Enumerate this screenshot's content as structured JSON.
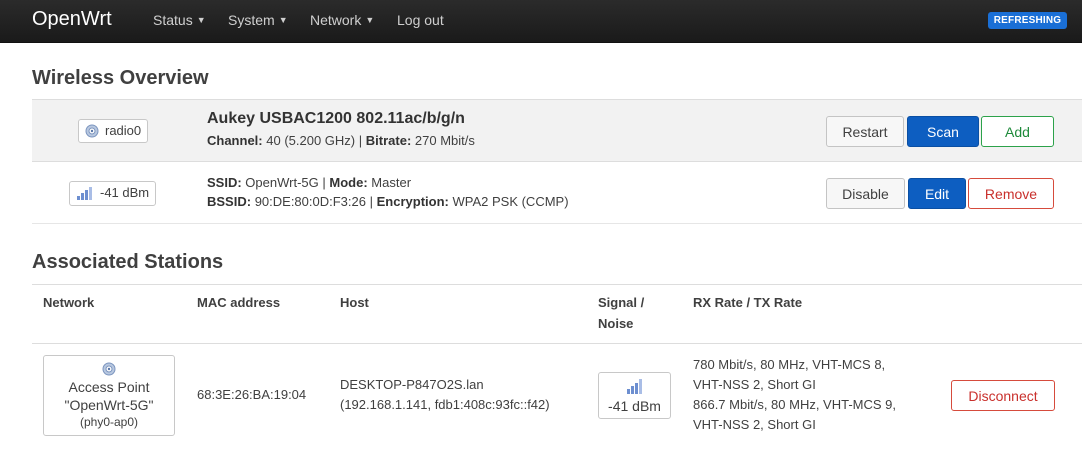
{
  "nav": {
    "brand": "OpenWrt",
    "items": [
      {
        "label": "Status",
        "dropdown": true
      },
      {
        "label": "System",
        "dropdown": true
      },
      {
        "label": "Network",
        "dropdown": true
      },
      {
        "label": "Log out",
        "dropdown": false
      }
    ],
    "status_badge": "REFRESHING"
  },
  "wireless": {
    "title": "Wireless Overview",
    "radio": {
      "badge": "radio0",
      "name": "Aukey USBAC1200 802.11ac/b/g/n",
      "channel_label": "Channel:",
      "channel_value": "40 (5.200 GHz)",
      "separator": "|",
      "bitrate_label": "Bitrate:",
      "bitrate_value": "270 Mbit/s",
      "buttons": {
        "restart": "Restart",
        "scan": "Scan",
        "add": "Add"
      }
    },
    "network": {
      "signal": "-41 dBm",
      "ssid_label": "SSID:",
      "ssid_value": "OpenWrt-5G",
      "mode_label": "Mode:",
      "mode_value": "Master",
      "bssid_label": "BSSID:",
      "bssid_value": "90:DE:80:0D:F3:26",
      "encryption_label": "Encryption:",
      "encryption_value": "WPA2 PSK (CCMP)",
      "buttons": {
        "disable": "Disable",
        "edit": "Edit",
        "remove": "Remove"
      }
    }
  },
  "stations": {
    "title": "Associated Stations",
    "columns": {
      "network": "Network",
      "mac": "MAC address",
      "host": "Host",
      "signal_l1": "Signal /",
      "signal_l2": "Noise",
      "rate": "RX Rate / TX Rate"
    },
    "rows": [
      {
        "network_l1": "Access Point",
        "network_l2": "\"OpenWrt-5G\"",
        "network_l3": "(phy0-ap0)",
        "mac": "68:3E:26:BA:19:04",
        "host_l1": "DESKTOP-P847O2S.lan",
        "host_l2": "(192.168.1.141, fdb1:408c:93fc::f42)",
        "signal": "-41 dBm",
        "rx_l1": "780 Mbit/s, 80 MHz, VHT-MCS 8,",
        "rx_l2": "VHT-NSS 2, Short GI",
        "tx_l1": "866.7 Mbit/s, 80 MHz, VHT-MCS 9,",
        "tx_l2": "VHT-NSS 2, Short GI",
        "action": "Disconnect"
      }
    ]
  },
  "colors": {
    "navbar": "#222222",
    "primary": "#0d5ec1",
    "success": "#2ca24a",
    "danger": "#d64b3c",
    "badge": "#1a6fd6"
  }
}
